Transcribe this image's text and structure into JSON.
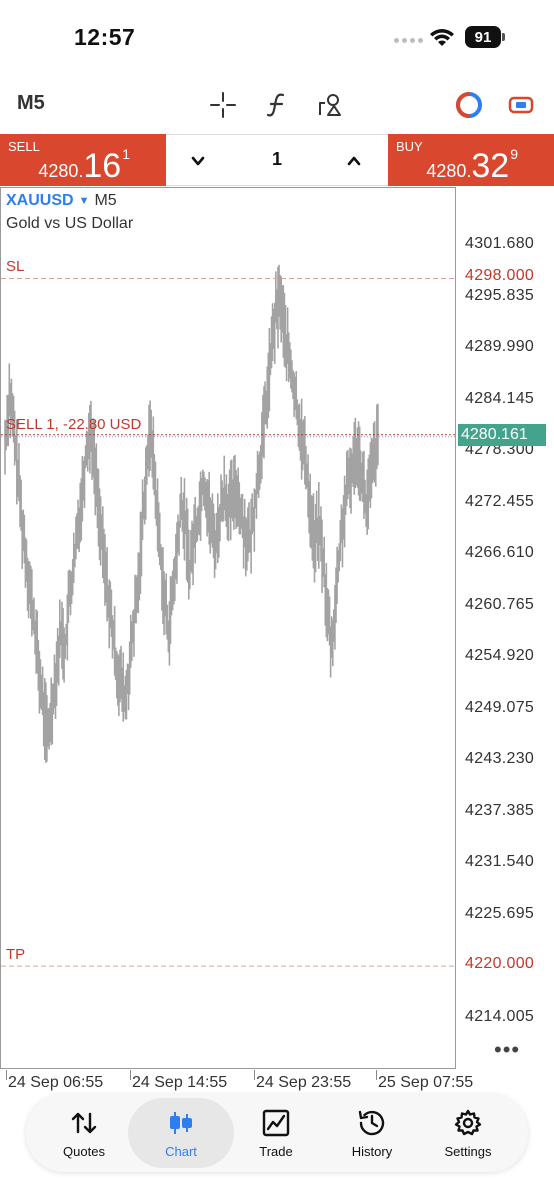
{
  "status": {
    "time": "12:57",
    "battery": "91"
  },
  "toolbar": {
    "timeframe": "M5"
  },
  "trade": {
    "sell_label": "SELL",
    "sell_price_main": "4280.",
    "sell_price_big": "16",
    "sell_price_sup": "1",
    "buy_label": "BUY",
    "buy_price_main": "4280.",
    "buy_price_big": "32",
    "buy_price_sup": "9",
    "volume": "1"
  },
  "chart_header": {
    "symbol": "XAUUSD",
    "timeframe": "M5",
    "description": "Gold vs US Dollar"
  },
  "chart_data": {
    "type": "bar",
    "price_axis": [
      "4301.680",
      "4295.835",
      "4289.990",
      "4284.145",
      "4278.300",
      "4272.455",
      "4266.610",
      "4260.765",
      "4254.920",
      "4249.075",
      "4243.230",
      "4237.385",
      "4231.540",
      "4225.695",
      "4214.005"
    ],
    "ylim": [
      4210.0,
      4306.0
    ],
    "x_labels": [
      "24 Sep 06:55",
      "24 Sep 14:55",
      "24 Sep 23:55",
      "25 Sep 07:55"
    ],
    "levels": {
      "sl": {
        "label": "SL",
        "price": 4298.0,
        "price_text": "4298.000"
      },
      "tp": {
        "label": "TP",
        "price": 4220.0,
        "price_text": "4220.000"
      },
      "position": {
        "label": "SELL 1, -22.80 USD",
        "price": 4280.161
      }
    },
    "current_price": {
      "price": 4280.161,
      "text": "4280.161"
    },
    "close_series": [
      4279,
      4285,
      4281,
      4276,
      4270,
      4266,
      4262,
      4258,
      4253,
      4249,
      4246,
      4250,
      4254,
      4258,
      4256,
      4262,
      4265,
      4270,
      4274,
      4279,
      4281,
      4276,
      4271,
      4266,
      4262,
      4258,
      4254,
      4252,
      4250,
      4254,
      4259,
      4263,
      4271,
      4277,
      4281,
      4274,
      4268,
      4262,
      4258,
      4262,
      4267,
      4272,
      4270,
      4265,
      4269,
      4271,
      4275,
      4273,
      4270,
      4268,
      4271,
      4274,
      4272,
      4273,
      4274,
      4271,
      4269,
      4268,
      4272,
      4276,
      4280,
      4285,
      4290,
      4294,
      4296,
      4292,
      4289,
      4286,
      4283,
      4280,
      4277,
      4272,
      4268,
      4270,
      4266,
      4260,
      4256,
      4262,
      4268,
      4272,
      4275,
      4277,
      4279,
      4276,
      4272,
      4275,
      4278,
      4280
    ]
  },
  "nav": {
    "items": [
      {
        "label": "Quotes"
      },
      {
        "label": "Chart"
      },
      {
        "label": "Trade"
      },
      {
        "label": "History"
      },
      {
        "label": "Settings"
      }
    ]
  }
}
